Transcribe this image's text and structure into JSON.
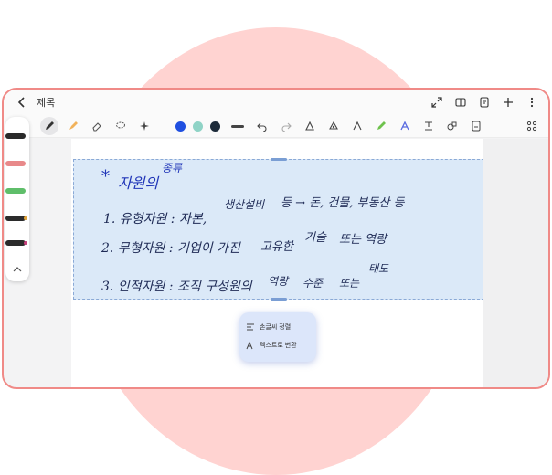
{
  "app": {
    "title": "제목"
  },
  "toolbar": {
    "colors": [
      "#1f4fe0",
      "#8fd3c6",
      "#1d2b3a"
    ],
    "icons": [
      "pen-icon",
      "highlighter-icon",
      "eraser-icon",
      "lasso-icon",
      "sparkle-icon",
      "undo-icon",
      "redo-icon"
    ]
  },
  "note": {
    "heading_marker": "*",
    "heading": "자원의",
    "heading_sup": "종류",
    "line1": "1. 유형자원 : 자본,",
    "line1_b": "생산설비",
    "line1_c": "등 → 돈, 건물, 부동산 등",
    "line2": "2. 무형자원 : 기업이 가진",
    "line2_b": "고유한",
    "line2_c": "기술",
    "line2_d": "또는 역량",
    "line3": "3. 인적자원 : 조직 구성원의",
    "line3_b": "역량",
    "line3_c": "수준",
    "line3_d": "또는",
    "line3_e": "태도"
  },
  "context_menu": {
    "item1": "손글씨 정렬",
    "item2": "텍스트로 변환"
  }
}
